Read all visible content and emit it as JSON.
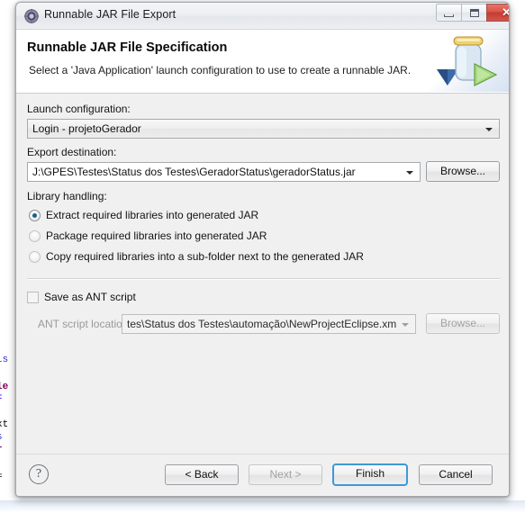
{
  "window": {
    "title": "Runnable JAR File Export",
    "icon": "eclipse-export-icon",
    "controls": {
      "minimize": "minimize-icon",
      "maximize": "restore-icon",
      "close": "✕"
    }
  },
  "banner": {
    "title": "Runnable JAR File Specification",
    "description": "Select a 'Java Application' launch configuration to use to create a runnable JAR.",
    "artwork": "runnable-jar-icon"
  },
  "form": {
    "launch_configuration": {
      "label": "Launch configuration:",
      "value": "Login - projetoGerador"
    },
    "export_destination": {
      "label": "Export destination:",
      "value": "J:\\GPES\\Testes\\Status dos Testes\\GeradorStatus\\geradorStatus.jar",
      "browse_label": "Browse..."
    },
    "library_handling": {
      "label": "Library handling:",
      "options": [
        {
          "label": "Extract required libraries into generated JAR",
          "selected": true
        },
        {
          "label": "Package required libraries into generated JAR",
          "selected": false
        },
        {
          "label": "Copy required libraries into a sub-folder next to the generated JAR",
          "selected": false
        }
      ]
    },
    "save_ant": {
      "label": "Save as ANT script",
      "checked": false
    },
    "ant_location": {
      "label": "ANT script location:",
      "value": "tes\\Status dos Testes\\automação\\NewProjectEclipse.xml",
      "browse_label": "Browse...",
      "enabled": false
    }
  },
  "buttons": {
    "help": "?",
    "back": "< Back",
    "next": "Next >",
    "finish": "Finish",
    "cancel": "Cancel"
  },
  "backdrop": {
    "code_fragments": [
      "is",
      "le",
      "F",
      "xt",
      "s",
      "r",
      "="
    ]
  },
  "colors": {
    "accent": "#3c9ad6",
    "close_button": "#c63b31",
    "radio_selected": "#18608f",
    "dialog_bg": "#f0f0f0",
    "banner_bg": "#ffffff"
  }
}
